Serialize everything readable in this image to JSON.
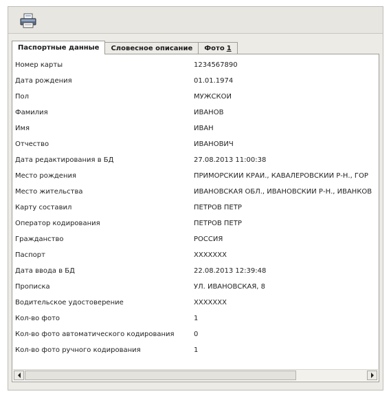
{
  "toolbar": {
    "print_icon": "printer-icon"
  },
  "tabs": [
    {
      "label": "Паспортные данные",
      "active": true
    },
    {
      "label": "Словесное описание",
      "active": false
    },
    {
      "label": "Фото",
      "suffix": "1",
      "active": false
    }
  ],
  "rows": [
    {
      "label": "Номер карты",
      "value": "1234567890"
    },
    {
      "label": "Дата рождения",
      "value": "01.01.1974"
    },
    {
      "label": "Пол",
      "value": "МУЖСКОЙ"
    },
    {
      "label": "Фамилия",
      "value": "ИВАНОВ"
    },
    {
      "label": "Имя",
      "value": "ИВАН"
    },
    {
      "label": "Отчество",
      "value": "ИВАНОВИЧ"
    },
    {
      "label": "Дата редактирования в БД",
      "value": "27.08.2013 11:00:38"
    },
    {
      "label": "Место рождения",
      "value": "ПРИМОРСКИЙ КРАЙ., КАВАЛЕРОВСКИЙ Р-Н., ГОР"
    },
    {
      "label": "Место жительства",
      "value": "ИВАНОВСКАЯ ОБЛ., ИВАНОВСКИЙ Р-Н., ИВАНКОВ"
    },
    {
      "label": "Карту составил",
      "value": "ПЕТРОВ ПЕТР"
    },
    {
      "label": "Оператор кодирования",
      "value": "ПЕТРОВ ПЕТР"
    },
    {
      "label": "Гражданство",
      "value": "РОССИЯ"
    },
    {
      "label": "Паспорт",
      "value": "XXXXXXX"
    },
    {
      "label": "Дата ввода в БД",
      "value": "22.08.2013 12:39:48"
    },
    {
      "label": "Прописка",
      "value": "УЛ. ИВАНОВСКАЯ, 8"
    },
    {
      "label": "Водительское удостоверение",
      "value": "XXXXXXX"
    },
    {
      "label": "Кол-во фото",
      "value": "1"
    },
    {
      "label": "Кол-во фото автоматического кодирования",
      "value": "0"
    },
    {
      "label": "Кол-во фото ручного кодирования",
      "value": "1"
    }
  ],
  "scrollbar": {
    "left_icon": "arrow-left-icon",
    "right_icon": "arrow-right-icon"
  }
}
